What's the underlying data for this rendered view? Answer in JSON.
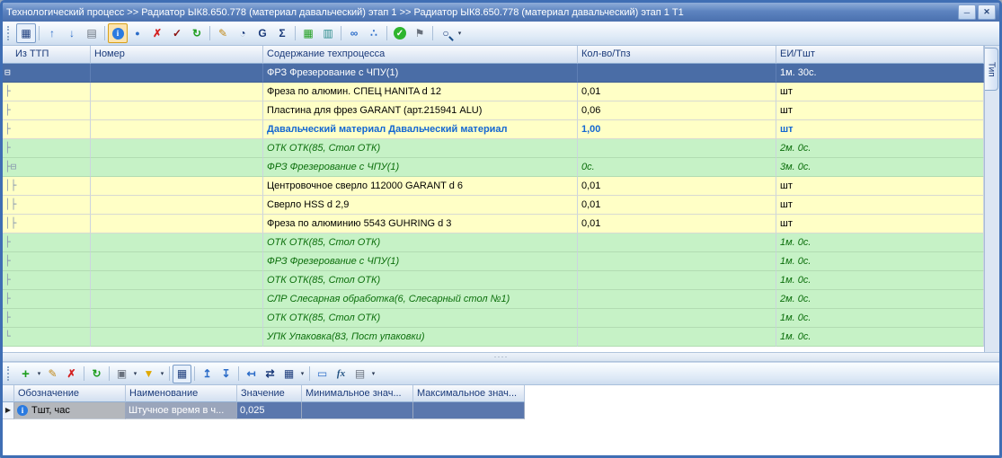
{
  "window": {
    "title": "Технологический процесс >> Радиатор ЫК8.650.778 (материал давальческий) этап 1 >> Радиатор ЫК8.650.778 (материал давальческий) этап 1 Т1",
    "minimize_label": "─",
    "close_label": "✕"
  },
  "colors": {
    "titlebar_blue": "#5d84c0",
    "row_selected_blue": "#4a6da6",
    "row_tool_yellow": "#ffffc6",
    "row_operation_green": "#c6f2c6",
    "material_text_blue": "#1467d2",
    "operation_text_green": "#0b6e0b"
  },
  "right_tab": {
    "label": "Тип"
  },
  "toolbar_top": {
    "icons": [
      {
        "name": "table-view-icon",
        "glyph": "▦"
      },
      {
        "name": "move-up-icon",
        "glyph": "↑"
      },
      {
        "name": "move-down-icon",
        "glyph": "↓"
      },
      {
        "name": "card-view-icon",
        "glyph": "▤"
      },
      {
        "name": "info-icon",
        "glyph": "i"
      },
      {
        "name": "drop-icon",
        "glyph": "●"
      },
      {
        "name": "delete-icon",
        "glyph": "✗"
      },
      {
        "name": "stamp-icon",
        "glyph": "✓"
      },
      {
        "name": "refresh-icon",
        "glyph": "↻"
      },
      {
        "name": "edit-pen-icon",
        "glyph": "✎"
      },
      {
        "name": "clock-icon",
        "glyph": "◔"
      },
      {
        "name": "group-calc-icon",
        "glyph": "G"
      },
      {
        "name": "sum-icon",
        "glyph": "Σ"
      },
      {
        "name": "excel-icon",
        "glyph": "▦"
      },
      {
        "name": "report-icon",
        "glyph": "▥"
      },
      {
        "name": "link-icon",
        "glyph": "∞"
      },
      {
        "name": "nodes-icon",
        "glyph": "∴"
      },
      {
        "name": "apply-icon",
        "glyph": "✓"
      },
      {
        "name": "flag-icon",
        "glyph": "⚑"
      },
      {
        "name": "zoom-icon",
        "glyph": "○"
      },
      {
        "name": "zoom-caret",
        "glyph": "▾"
      }
    ]
  },
  "main_grid": {
    "columns": [
      "Из ТТП",
      "Номер",
      "Содержание техпроцесса",
      "Кол-во/Тпз",
      "ЕИ/Тшт"
    ],
    "rows": [
      {
        "tree": "⊟",
        "content": "ФРЗ Фрезерование с ЧПУ(1)",
        "qty": "",
        "unit": "1м. 30с."
      },
      {
        "tree": "├",
        "content": "Фреза по алюмин. СПЕЦ HANITA d 12",
        "qty": "0,01",
        "unit": "шт"
      },
      {
        "tree": "├",
        "content": "Пластина для фрез GARANT (арт.215941 ALU)",
        "qty": "0,06",
        "unit": "шт"
      },
      {
        "tree": "├",
        "content": "Давальческий материал Давальческий материал",
        "qty": "1,00",
        "unit": "шт"
      },
      {
        "tree": "├",
        "content": "ОТК ОТК(85, Стол ОТК)",
        "qty": "",
        "unit": "2м. 0с."
      },
      {
        "tree": "├⊟",
        "content": "ФРЗ Фрезерование с ЧПУ(1)",
        "qty": "0с.",
        "unit": "3м. 0с."
      },
      {
        "tree": "│├",
        "content": "Центровочное сверло 112000 GARANT d 6",
        "qty": "0,01",
        "unit": "шт"
      },
      {
        "tree": "│├",
        "content": "Сверло HSS d 2,9",
        "qty": "0,01",
        "unit": "шт"
      },
      {
        "tree": "│├",
        "content": "Фреза по алюминию 5543 GUHRING d 3",
        "qty": "0,01",
        "unit": "шт"
      },
      {
        "tree": "├",
        "content": "ОТК ОТК(85, Стол ОТК)",
        "qty": "",
        "unit": "1м. 0с."
      },
      {
        "tree": "├",
        "content": "ФРЗ Фрезерование с ЧПУ(1)",
        "qty": "",
        "unit": "1м. 0с."
      },
      {
        "tree": "├",
        "content": "ОТК ОТК(85, Стол ОТК)",
        "qty": "",
        "unit": "1м. 0с."
      },
      {
        "tree": "├",
        "content": "СЛР Слесарная обработка(6, Слесарный стол №1)",
        "qty": "",
        "unit": "2м. 0с."
      },
      {
        "tree": "├",
        "content": "ОТК ОТК(85, Стол ОТК)",
        "qty": "",
        "unit": "1м. 0с."
      },
      {
        "tree": "└",
        "content": "УПК Упаковка(83, Пост упаковки)",
        "qty": "",
        "unit": "1м. 0с."
      }
    ]
  },
  "splitter_dots": "····",
  "toolbar_bottom": {
    "icons": [
      {
        "name": "add-icon",
        "glyph": "+"
      },
      {
        "name": "add-caret",
        "glyph": "▾"
      },
      {
        "name": "edit-icon",
        "glyph": "✎"
      },
      {
        "name": "delete-icon",
        "glyph": "✗"
      },
      {
        "name": "refresh-icon",
        "glyph": "↻"
      },
      {
        "name": "print-icon",
        "glyph": "▣"
      },
      {
        "name": "print-caret",
        "glyph": "▾"
      },
      {
        "name": "filter-icon",
        "glyph": "▼"
      },
      {
        "name": "filter-caret",
        "glyph": "▾"
      },
      {
        "name": "card-view-icon",
        "glyph": "▦"
      },
      {
        "name": "insert-above-icon",
        "glyph": "↥"
      },
      {
        "name": "insert-below-icon",
        "glyph": "↧"
      },
      {
        "name": "shift-left-icon",
        "glyph": "↤"
      },
      {
        "name": "swap-icon",
        "glyph": "⇄"
      },
      {
        "name": "table-icon",
        "glyph": "▦"
      },
      {
        "name": "table-caret",
        "glyph": "▾"
      },
      {
        "name": "comment-icon",
        "glyph": "▭"
      },
      {
        "name": "fx-icon",
        "glyph": "fx"
      },
      {
        "name": "export-icon",
        "glyph": "▤"
      },
      {
        "name": "export-caret",
        "glyph": "▾"
      }
    ]
  },
  "param_grid": {
    "columns": [
      "Обозначение",
      "Наименование",
      "Значение",
      "Минимальное знач...",
      "Максимальное знач..."
    ],
    "row_indicator": "▶",
    "info_icon": "i",
    "row": {
      "designation": "Тшт, час",
      "name": "Штучное время в ч...",
      "value": "0,025",
      "min": "",
      "max": ""
    }
  }
}
